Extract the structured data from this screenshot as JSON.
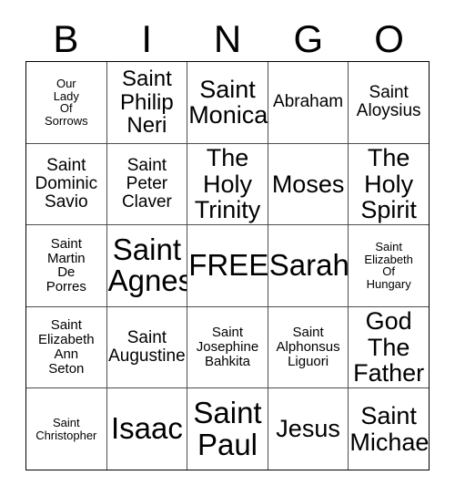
{
  "header": {
    "letters": [
      "B",
      "I",
      "N",
      "G",
      "O"
    ]
  },
  "grid": {
    "rows": [
      [
        {
          "text": "Our\nLady\nOf\nSorrows",
          "size": "fs-xs"
        },
        {
          "text": "Saint\nPhilip\nNeri",
          "size": "fs-lg"
        },
        {
          "text": "Saint\nMonica",
          "size": "fs-xl"
        },
        {
          "text": "Abraham",
          "size": "fs-md"
        },
        {
          "text": "Saint\nAloysius",
          "size": "fs-md"
        }
      ],
      [
        {
          "text": "Saint\nDominic\nSavio",
          "size": "fs-md"
        },
        {
          "text": "Saint\nPeter\nClaver",
          "size": "fs-md"
        },
        {
          "text": "The\nHoly\nTrinity",
          "size": "fs-xl"
        },
        {
          "text": "Moses",
          "size": "fs-xl"
        },
        {
          "text": "The\nHoly\nSpirit",
          "size": "fs-xl"
        }
      ],
      [
        {
          "text": "Saint\nMartin\nDe\nPorres",
          "size": "fs-sm"
        },
        {
          "text": "Saint\nAgnes",
          "size": "fs-xxl"
        },
        {
          "text": "FREE!",
          "size": "fs-xxl"
        },
        {
          "text": "Sarah",
          "size": "fs-xxl"
        },
        {
          "text": "Saint\nElizabeth\nOf\nHungary",
          "size": "fs-xs"
        }
      ],
      [
        {
          "text": "Saint\nElizabeth\nAnn\nSeton",
          "size": "fs-sm"
        },
        {
          "text": "Saint\nAugustine",
          "size": "fs-md"
        },
        {
          "text": "Saint\nJosephine\nBahkita",
          "size": "fs-sm"
        },
        {
          "text": "Saint\nAlphonsus\nLiguori",
          "size": "fs-sm"
        },
        {
          "text": "God\nThe\nFather",
          "size": "fs-xl"
        }
      ],
      [
        {
          "text": "Saint\nChristopher",
          "size": "fs-xs"
        },
        {
          "text": "Isaac",
          "size": "fs-xxl"
        },
        {
          "text": "Saint\nPaul",
          "size": "fs-xxl"
        },
        {
          "text": "Jesus",
          "size": "fs-xl"
        },
        {
          "text": "Saint\nMichael",
          "size": "fs-xl"
        }
      ]
    ]
  }
}
